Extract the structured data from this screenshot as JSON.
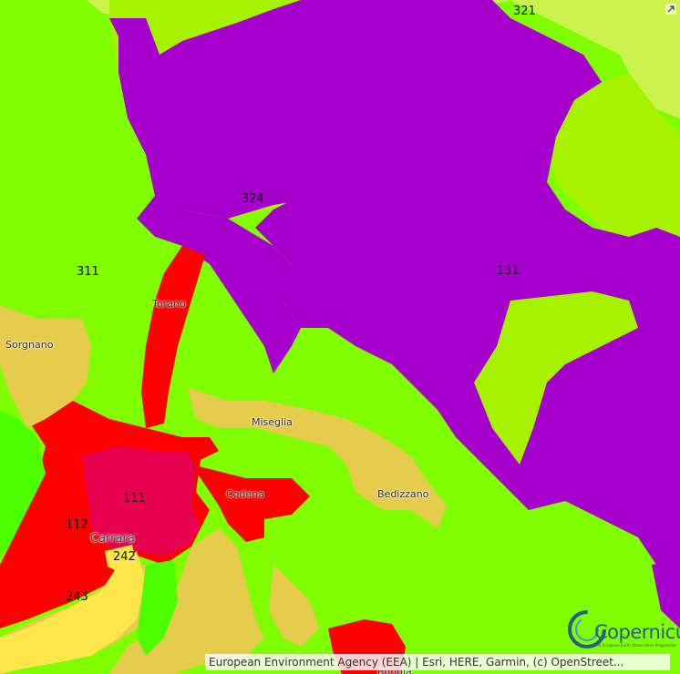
{
  "colors": {
    "c111": "#e6004d",
    "c112": "#ff0000",
    "c131": "#a600cc",
    "c242": "#ffe64d",
    "c243": "#e6cc4d",
    "c311": "#80ff00",
    "c324": "#a6f200",
    "c321": "#ccf24d",
    "c313": "#4dff00"
  },
  "map": {
    "codes": {
      "c321": "321",
      "c324": "324",
      "c311": "311",
      "c131": "131",
      "c111": "111",
      "c112": "112",
      "c242": "242",
      "c243": "243"
    },
    "places": {
      "torano": "Torano",
      "sorgnano": "Sorgnano",
      "miseglia": "Miseglia",
      "codena": "Codena",
      "bedizzano": "Bedizzano",
      "carrara": "Carrara",
      "bottom": "Bonola"
    },
    "attribution": "European Environment Agency (EEA) | Esri, HERE, Garmin, (c) OpenStreet...",
    "logo": {
      "name": "Copernicus",
      "tagline": "The European Earth Observation Programme"
    },
    "icons": {
      "expand": "expand-arrow-icon"
    }
  }
}
